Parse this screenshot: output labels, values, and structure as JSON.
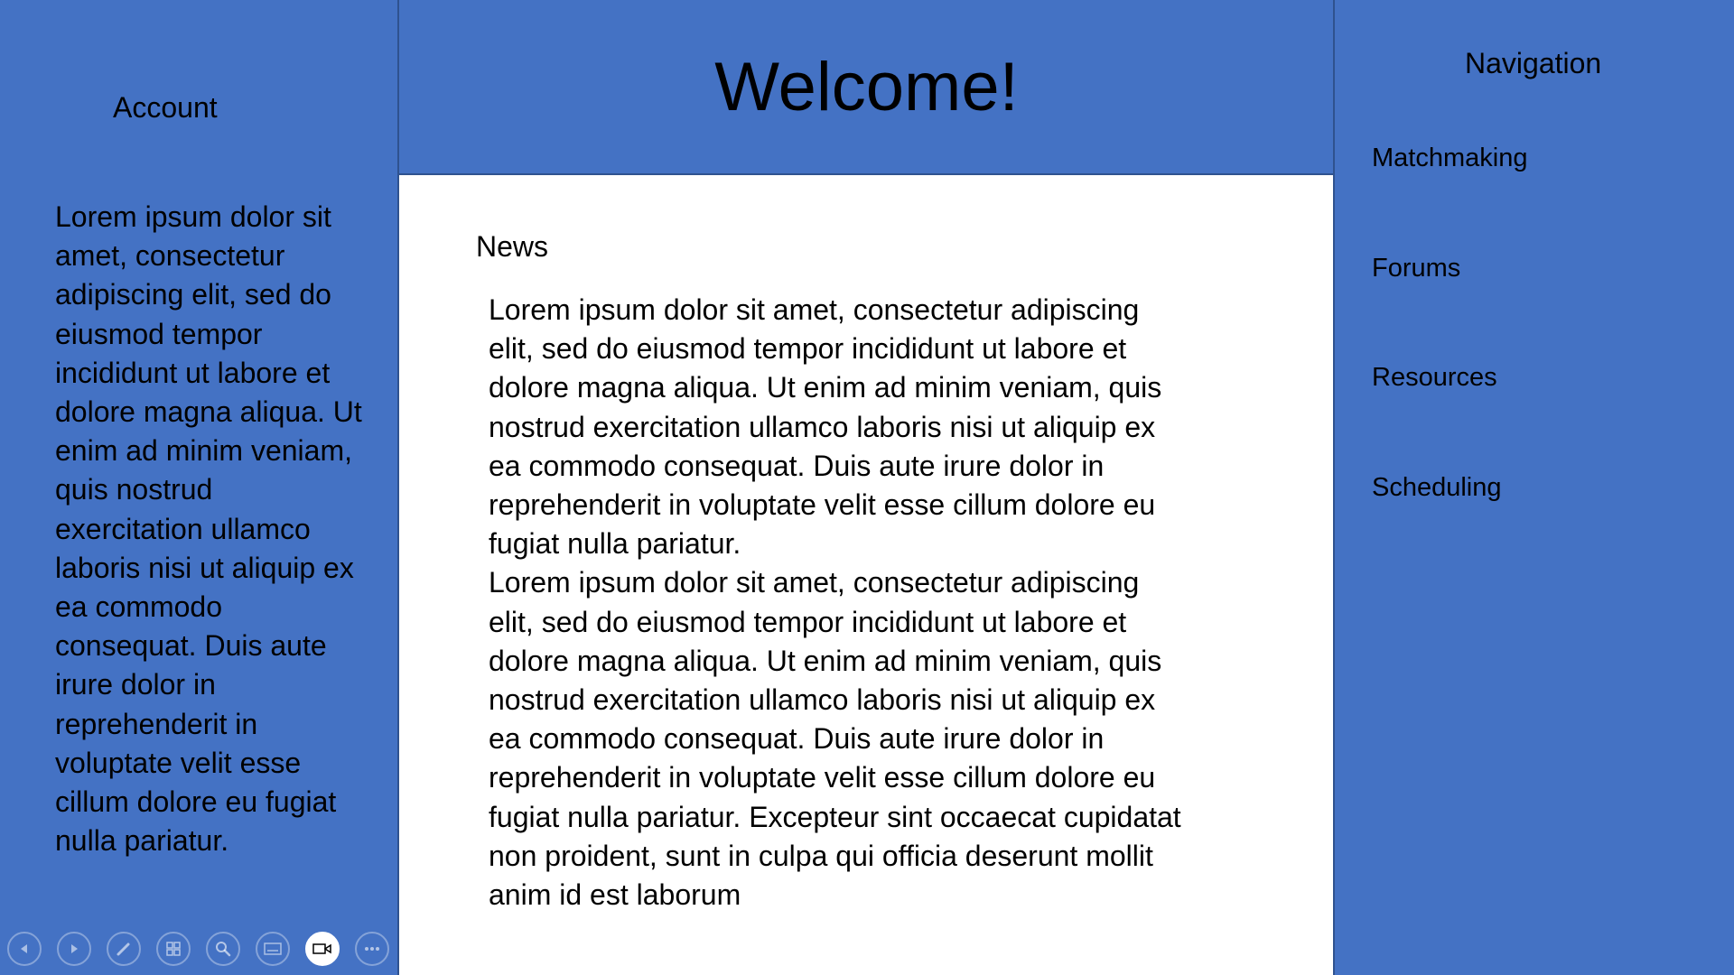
{
  "header": {
    "title": "Welcome!"
  },
  "account": {
    "title": "Account",
    "text": "Lorem ipsum dolor sit amet, consectetur adipiscing elit, sed do eiusmod tempor incididunt ut labore et dolore magna aliqua. Ut enim ad minim veniam, quis nostrud exercitation ullamco laboris nisi ut aliquip ex ea commodo consequat. Duis aute irure dolor in reprehenderit in voluptate velit esse cillum dolore eu fugiat nulla pariatur."
  },
  "news": {
    "title": "News",
    "paragraphs": [
      "Lorem ipsum dolor sit amet, consectetur adipiscing elit, sed do eiusmod tempor incididunt ut labore et dolore magna aliqua. Ut enim ad minim veniam, quis nostrud exercitation ullamco laboris nisi ut aliquip ex ea commodo consequat. Duis aute irure dolor in reprehenderit in voluptate velit esse cillum dolore eu fugiat nulla pariatur.",
      "Lorem ipsum dolor sit amet, consectetur adipiscing elit, sed do eiusmod tempor incididunt ut labore et dolore magna aliqua. Ut enim ad minim veniam, quis nostrud exercitation ullamco laboris nisi ut aliquip ex ea commodo consequat. Duis aute irure dolor in reprehenderit in voluptate velit esse cillum dolore eu fugiat nulla pariatur. Excepteur sint occaecat cupidatat non proident, sunt in culpa qui officia deserunt mollit anim id est laborum"
    ]
  },
  "navigation": {
    "title": "Navigation",
    "items": [
      {
        "label": "Matchmaking"
      },
      {
        "label": "Forums"
      },
      {
        "label": "Resources"
      },
      {
        "label": "Scheduling"
      }
    ]
  },
  "toolbar": {
    "buttons": [
      {
        "icon": "previous-icon"
      },
      {
        "icon": "next-icon"
      },
      {
        "icon": "pen-icon"
      },
      {
        "icon": "slides-grid-icon"
      },
      {
        "icon": "zoom-icon"
      },
      {
        "icon": "subtitles-icon"
      },
      {
        "icon": "camera-icon",
        "active": true
      },
      {
        "icon": "more-options-icon"
      }
    ]
  },
  "colors": {
    "panel": "#4472c4",
    "panel_border": "#2f528f",
    "content_bg": "#ffffff",
    "text": "#000000"
  }
}
